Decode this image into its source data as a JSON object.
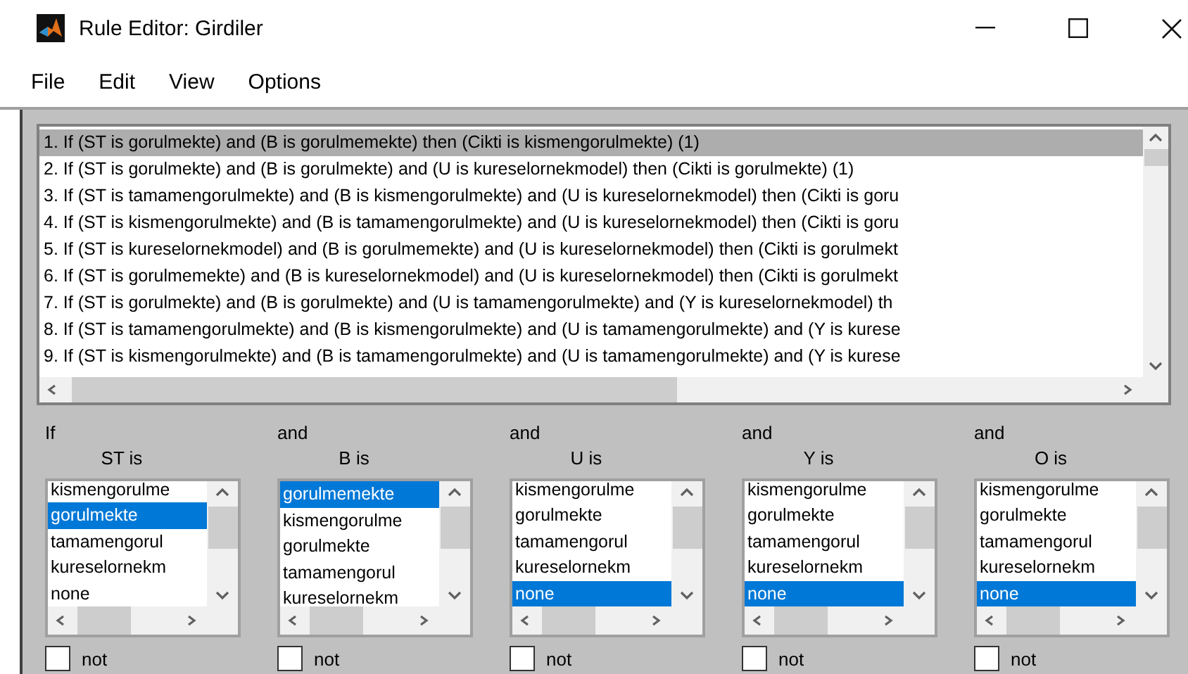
{
  "window": {
    "title": "Rule Editor: Girdiler"
  },
  "menu": [
    "File",
    "Edit",
    "View",
    "Options"
  ],
  "rules": [
    {
      "text": "1. If (ST is gorulmekte) and (B is gorulmemekte) then (Cikti is kismengorulmekte) (1)",
      "selected": true
    },
    {
      "text": "2. If (ST is gorulmekte) and (B is gorulmekte) and (U is kureselornekmodel) then (Cikti is gorulmekte) (1)",
      "selected": false
    },
    {
      "text": "3. If (ST is tamamengorulmekte) and (B is kismengorulmekte) and (U is kureselornekmodel) then (Cikti is goru",
      "selected": false
    },
    {
      "text": "4. If (ST is kismengorulmekte) and (B is tamamengorulmekte) and (U is kureselornekmodel) then (Cikti is goru",
      "selected": false
    },
    {
      "text": "5. If (ST is kureselornekmodel) and (B is gorulmemekte) and (U is kureselornekmodel) then (Cikti is gorulmekt",
      "selected": false
    },
    {
      "text": "6. If (ST is gorulmemekte) and (B is kureselornekmodel) and (U is kureselornekmodel) then (Cikti is gorulmekt",
      "selected": false
    },
    {
      "text": "7. If (ST is gorulmekte) and (B is gorulmekte) and (U is tamamengorulmekte) and (Y is kureselornekmodel) th",
      "selected": false
    },
    {
      "text": "8. If (ST is tamamengorulmekte) and (B is kismengorulmekte) and (U is tamamengorulmekte) and (Y is kurese",
      "selected": false
    },
    {
      "text": "9. If (ST is kismengorulmekte) and (B is tamamengorulmekte) and (U is tamamengorulmekte) and (Y is kurese",
      "selected": false
    }
  ],
  "inputs": [
    {
      "connective": "If",
      "label": "ST is",
      "options": [
        {
          "text": "kismengorulme",
          "selected": false
        },
        {
          "text": "gorulmekte",
          "selected": true
        },
        {
          "text": "tamamengorul",
          "selected": false
        },
        {
          "text": "kureselornekm",
          "selected": false
        },
        {
          "text": "none",
          "selected": false
        }
      ],
      "not_label": "not",
      "not_checked": false
    },
    {
      "connective": "and",
      "label": "B is",
      "options": [
        {
          "text": "gorulmemekte",
          "selected": true
        },
        {
          "text": "kismengorulme",
          "selected": false
        },
        {
          "text": "gorulmekte",
          "selected": false
        },
        {
          "text": "tamamengorul",
          "selected": false
        },
        {
          "text": "kureselornekm",
          "selected": false
        }
      ],
      "not_label": "not",
      "not_checked": false
    },
    {
      "connective": "and",
      "label": "U is",
      "options": [
        {
          "text": "kismengorulme",
          "selected": false
        },
        {
          "text": "gorulmekte",
          "selected": false
        },
        {
          "text": "tamamengorul",
          "selected": false
        },
        {
          "text": "kureselornekm",
          "selected": false
        },
        {
          "text": "none",
          "selected": true
        }
      ],
      "not_label": "not",
      "not_checked": false
    },
    {
      "connective": "and",
      "label": "Y is",
      "options": [
        {
          "text": "kismengorulme",
          "selected": false
        },
        {
          "text": "gorulmekte",
          "selected": false
        },
        {
          "text": "tamamengorul",
          "selected": false
        },
        {
          "text": "kureselornekm",
          "selected": false
        },
        {
          "text": "none",
          "selected": true
        }
      ],
      "not_label": "not",
      "not_checked": false
    },
    {
      "connective": "and",
      "label": "O is",
      "options": [
        {
          "text": "kismengorulme",
          "selected": false
        },
        {
          "text": "gorulmekte",
          "selected": false
        },
        {
          "text": "tamamengorul",
          "selected": false
        },
        {
          "text": "kureselornekm",
          "selected": false
        },
        {
          "text": "none",
          "selected": true
        }
      ],
      "not_label": "not",
      "not_checked": false
    }
  ]
}
